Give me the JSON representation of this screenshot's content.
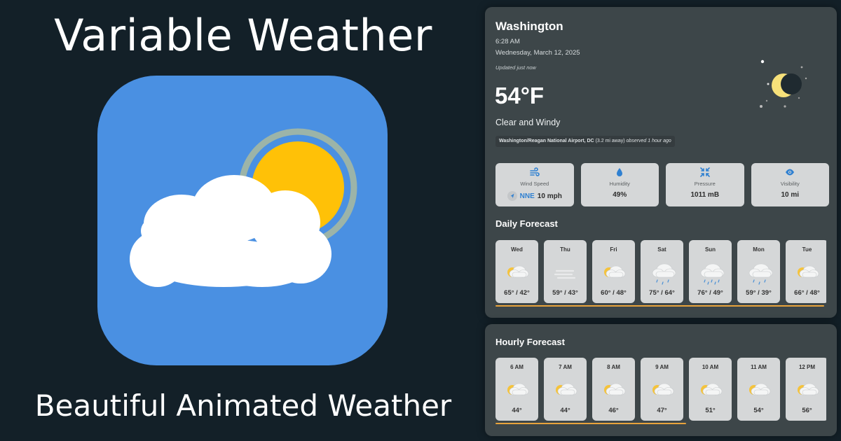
{
  "promo": {
    "title": "Variable Weather",
    "subtitle": "Beautiful Animated Weather"
  },
  "current": {
    "city": "Washington",
    "time": "6:28 AM",
    "date": "Wednesday, March 12, 2025",
    "updated": "Updated just now",
    "temperature": "54°F",
    "condition": "Clear and Windy",
    "station_name": "Washington/Reagan National Airport, DC",
    "station_distance": "(3.2 mi away)",
    "station_observed": "observed 1 hour ago"
  },
  "metrics": [
    {
      "label": "Wind Speed",
      "direction": "NNE",
      "value": "10 mph",
      "icon": "wind-icon"
    },
    {
      "label": "Humidity",
      "value": "49%",
      "icon": "droplet-icon"
    },
    {
      "label": "Pressure",
      "value": "1011 mB",
      "icon": "compress-icon"
    },
    {
      "label": "Visibility",
      "value": "10 mi",
      "icon": "eye-icon"
    }
  ],
  "daily": {
    "title": "Daily Forecast",
    "days": [
      {
        "label": "Wed",
        "temps": "65° / 42°",
        "icon": "partly-cloudy-icon"
      },
      {
        "label": "Thu",
        "temps": "59° / 43°",
        "icon": "fog-icon"
      },
      {
        "label": "Fri",
        "temps": "60° / 48°",
        "icon": "partly-cloudy-icon"
      },
      {
        "label": "Sat",
        "temps": "75° / 64°",
        "icon": "rain-icon"
      },
      {
        "label": "Sun",
        "temps": "76° / 49°",
        "icon": "heavy-rain-icon"
      },
      {
        "label": "Mon",
        "temps": "59° / 39°",
        "icon": "rain-icon"
      },
      {
        "label": "Tue",
        "temps": "66° / 48°",
        "icon": "partly-cloudy-icon"
      }
    ]
  },
  "hourly": {
    "title": "Hourly Forecast",
    "hours": [
      {
        "label": "6 AM",
        "temp": "44°",
        "icon": "partly-cloudy-icon"
      },
      {
        "label": "7 AM",
        "temp": "44°",
        "icon": "partly-cloudy-icon"
      },
      {
        "label": "8 AM",
        "temp": "46°",
        "icon": "partly-cloudy-icon"
      },
      {
        "label": "9 AM",
        "temp": "47°",
        "icon": "partly-cloudy-icon"
      },
      {
        "label": "10 AM",
        "temp": "51°",
        "icon": "partly-cloudy-icon"
      },
      {
        "label": "11 AM",
        "temp": "54°",
        "icon": "partly-cloudy-icon"
      },
      {
        "label": "12 PM",
        "temp": "56°",
        "icon": "partly-cloudy-icon"
      }
    ]
  },
  "colors": {
    "background": "#132028",
    "icon_background": "#4a90e2",
    "sun": "#ffc107",
    "panel": "#3d4649",
    "card": "#d5d7d8",
    "accent": "#e8a33c",
    "metric_icon": "#2f80d1"
  }
}
